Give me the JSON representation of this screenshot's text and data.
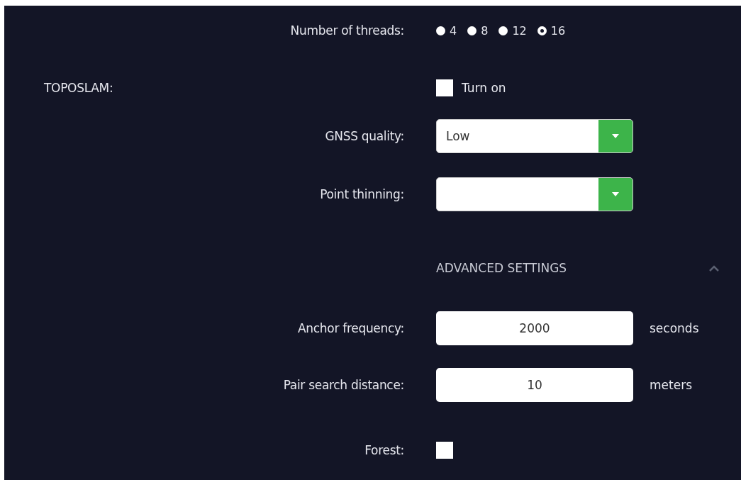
{
  "threads": {
    "label": "Number of threads:",
    "options": [
      {
        "label": "4",
        "selected": false
      },
      {
        "label": "8",
        "selected": false
      },
      {
        "label": "12",
        "selected": false
      },
      {
        "label": "16",
        "selected": true
      }
    ]
  },
  "toposlam": {
    "label": "TOPOSLAM:",
    "turn_on": {
      "label": "Turn on",
      "checked": false
    }
  },
  "gnss_quality": {
    "label": "GNSS quality:",
    "value": "Low"
  },
  "point_thinning": {
    "label": "Point thinning:"
  },
  "advanced": {
    "title": "ADVANCED SETTINGS",
    "expanded": true
  },
  "anchor_frequency": {
    "label": "Anchor frequency:",
    "value": "2000",
    "unit": "seconds"
  },
  "pair_search_distance": {
    "label": "Pair search distance:",
    "value": "10",
    "unit": "meters"
  },
  "forest": {
    "label": "Forest:",
    "checked": false
  }
}
